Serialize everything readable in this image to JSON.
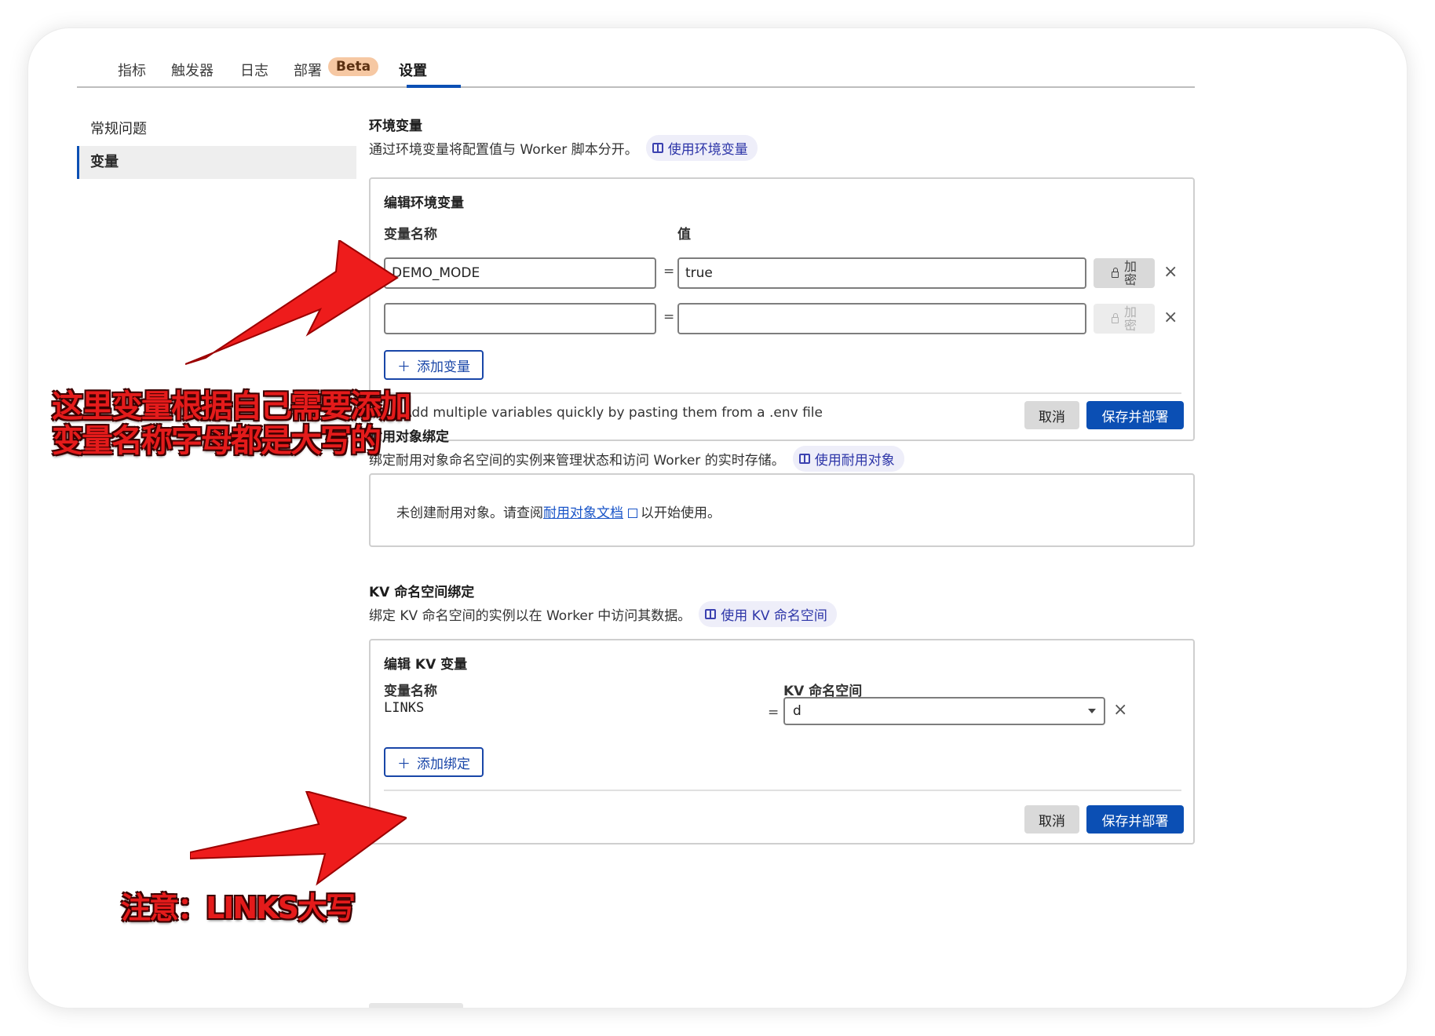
{
  "tabs": [
    {
      "label": "指标"
    },
    {
      "label": "触发器"
    },
    {
      "label": "日志"
    },
    {
      "label": "部署",
      "badge": "Beta"
    },
    {
      "label": "设置",
      "active": true
    }
  ],
  "sidebar": {
    "items": [
      {
        "label": "常规问题"
      },
      {
        "label": "变量",
        "active": true
      }
    ]
  },
  "env_vars": {
    "title": "环境变量",
    "description": "通过环境变量将配置值与 Worker 脚本分开。",
    "doc_link": "使用环境变量",
    "card_title": "编辑环境变量",
    "col_name": "变量名称",
    "col_value": "值",
    "rows": [
      {
        "name": "DEMO_MODE",
        "value": "true",
        "encrypt_label": "加密"
      },
      {
        "name": "",
        "value": "",
        "encrypt_label": "加密"
      }
    ],
    "eq": "=",
    "add_button": "添加变量",
    "hint": "Add multiple variables quickly by pasting them from a .env file",
    "cancel": "取消",
    "save": "保存并部署"
  },
  "durable_objects": {
    "title": "耐用对象绑定",
    "description": "绑定耐用对象命名空间的实例来管理状态和访问 Worker 的实时存储。",
    "doc_link": "使用耐用对象",
    "empty_prefix": "未创建耐用对象。请查阅",
    "empty_link": "耐用对象文档",
    "empty_suffix": "以开始使用。"
  },
  "kv": {
    "title": "KV 命名空间绑定",
    "description": "绑定 KV 命名空间的实例以在 Worker 中访问其数据。",
    "doc_link": "使用 KV 命名空间",
    "card_title": "编辑 KV 变量",
    "col_name": "变量名称",
    "col_namespace": "KV 命名空间",
    "rows": [
      {
        "name": "LINKS",
        "namespace": "d"
      }
    ],
    "eq": "=",
    "add_button": "添加绑定",
    "cancel": "取消",
    "save": "保存并部署"
  },
  "annotations": {
    "note1_line1": "这里变量根据自己需要添加",
    "note1_line2": "变量名称字母都是大写的",
    "note2": "注意：LINKS大写"
  },
  "colors": {
    "primary": "#0b4fb4",
    "annotation_red": "#e41b1b",
    "beta_badge": "#f6c8a3"
  },
  "icons": {
    "doc": "book-icon",
    "lock": "lock-icon",
    "close": "close-icon",
    "add": "plus-icon",
    "external": "external-link-icon",
    "dropdown": "chevron-down-icon"
  }
}
